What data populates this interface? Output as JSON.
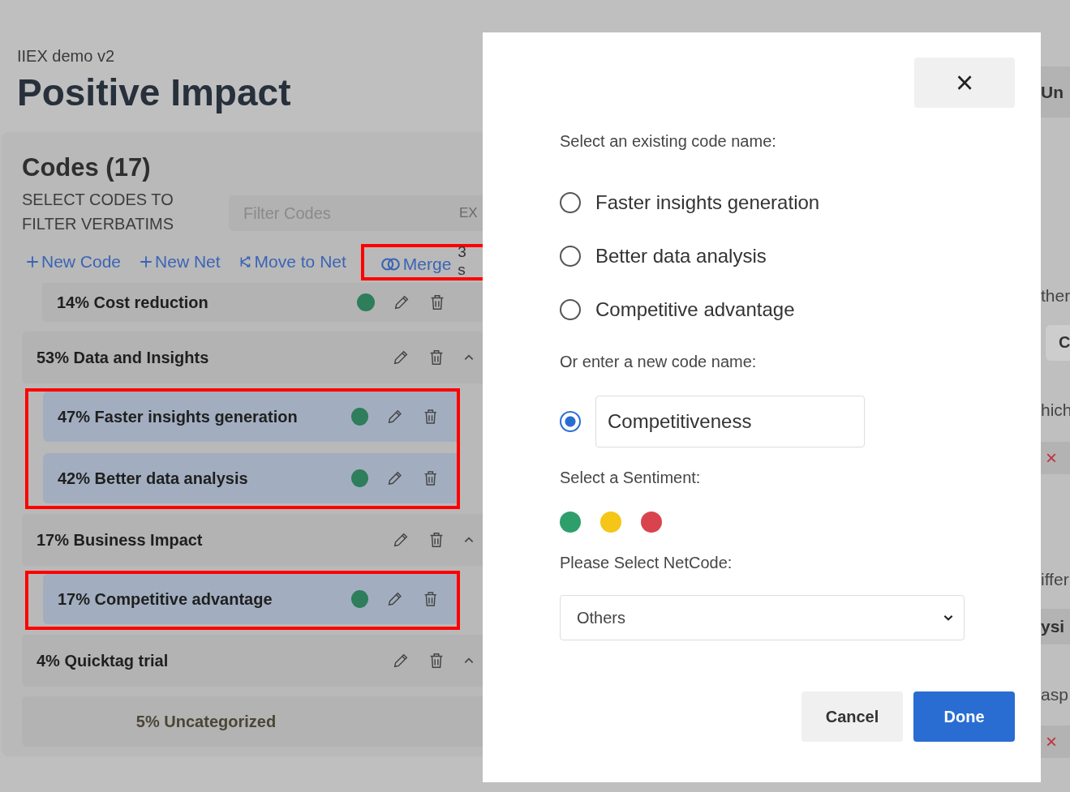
{
  "header": {
    "project": "IIEX demo v2",
    "title": "Positive Impact"
  },
  "codes_panel": {
    "title": "Codes (17)",
    "subtitle": "SELECT CODES TO FILTER VERBATIMS",
    "filter": {
      "placeholder": "Filter Codes"
    },
    "filter_trailing": "EX",
    "actions": [
      {
        "kind": "plus",
        "label": "New Code",
        "annotated": false
      },
      {
        "kind": "plus",
        "label": "New Net",
        "annotated": false
      },
      {
        "kind": "move",
        "label": "Move to Net",
        "annotated": false
      },
      {
        "kind": "merge",
        "label": "Merge",
        "annotated": true
      }
    ],
    "selected_count": "3",
    "selected_suffix": "s",
    "rows": [
      {
        "kind": "code",
        "label": "14% Cost reduction",
        "color": "#2e7d5b"
      },
      {
        "kind": "net",
        "label": "53% Data and Insights",
        "expanded": true
      },
      {
        "kind": "annotated",
        "rows": [
          {
            "kind": "code",
            "label": "47% Faster insights generation",
            "color": "#2e7d5b",
            "selected": true
          },
          {
            "kind": "code",
            "label": "42% Better data analysis",
            "color": "#2e7d5b",
            "selected": true
          }
        ]
      },
      {
        "kind": "net",
        "label": "17% Business Impact",
        "expanded": true
      },
      {
        "kind": "annotated",
        "rows": [
          {
            "kind": "code",
            "label": "17% Competitive advantage",
            "color": "#2e7d5b",
            "selected": true
          }
        ]
      },
      {
        "kind": "net",
        "label": "4% Quicktag trial",
        "expanded": true
      },
      {
        "kind": "uncategorized",
        "label": "5% Uncategorized"
      }
    ]
  },
  "right_edge": [
    {
      "kind": "bold",
      "text": "Un"
    },
    {
      "kind": "text",
      "text": "ther"
    },
    {
      "kind": "box",
      "text": "C"
    },
    {
      "kind": "text",
      "text": "hich"
    },
    {
      "kind": "remove",
      "text": "×"
    },
    {
      "kind": "text",
      "text": "iffer"
    },
    {
      "kind": "bold",
      "text": "ysi"
    },
    {
      "kind": "text",
      "text": "asp"
    },
    {
      "kind": "remove",
      "text": "×"
    }
  ],
  "dialog": {
    "close": "×",
    "existing_label": "Select an existing code name:",
    "options": [
      {
        "label": "Faster insights generation",
        "selected": false
      },
      {
        "label": "Better data analysis",
        "selected": false
      },
      {
        "label": "Competitive advantage",
        "selected": false
      }
    ],
    "new_label": "Or enter a new code name:",
    "new_option": {
      "selected": true,
      "value": "Competitiveness"
    },
    "sentiment_label": "Select a Sentiment:",
    "sentiments": [
      {
        "color": "#2e9e6b"
      },
      {
        "color": "#f5c518"
      },
      {
        "color": "#d9434e"
      }
    ],
    "netcode_label": "Please Select NetCode:",
    "netcode": {
      "value": "Others"
    },
    "buttons": [
      {
        "kind": "secondary",
        "label": "Cancel"
      },
      {
        "kind": "primary",
        "label": "Done"
      }
    ]
  }
}
